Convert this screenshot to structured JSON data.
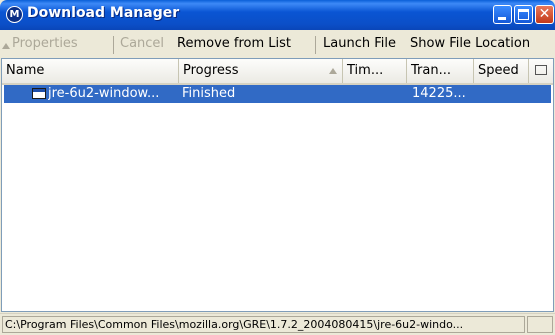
{
  "window": {
    "title": "Download Manager",
    "icon": "mozilla-icon",
    "icon_glyph": "M"
  },
  "toolbar": {
    "properties": "Properties",
    "cancel": "Cancel",
    "remove_from_list": "Remove from List",
    "launch_file": "Launch File",
    "show_file_location": "Show File Location"
  },
  "columns": [
    "Name",
    "Progress",
    "Tim...",
    "Tran...",
    "Speed"
  ],
  "rows": [
    {
      "name": "jre-6u2-window...",
      "progress": "Finished",
      "time": "",
      "transferred": "14225...",
      "speed": ""
    }
  ],
  "statusbar": {
    "path": "C:\\Program Files\\Common Files\\mozilla.org\\GRE\\1.7.2_2004080415\\jre-6u2-windo..."
  },
  "colors": {
    "titlebar": "#0a55d4",
    "selection": "#316ac5",
    "close_button": "#c2391a"
  }
}
